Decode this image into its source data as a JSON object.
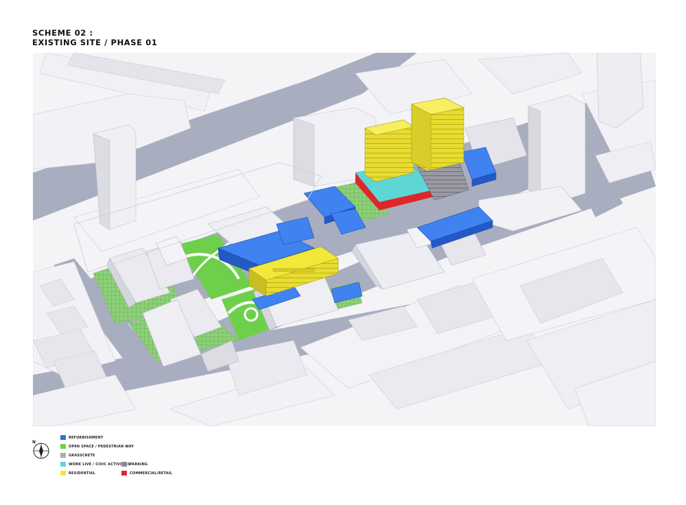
{
  "title": {
    "line1": "SCHEME 02 :",
    "line2": "EXISTING SITE / PHASE 01"
  },
  "legend": {
    "north_label": "N",
    "items": [
      {
        "label": "REFURBISHMENT",
        "color": "#2f6fe0",
        "pattern": "solid"
      },
      {
        "label": "OPEN SPACE / PEDESTRIAN WAY",
        "color": "#6ed04a",
        "pattern": "solid"
      },
      {
        "label": "GRASSCRETE",
        "color": "#c8c8c8",
        "pattern": "grid"
      },
      {
        "label": "WORK LIVE / CIVIC ACTIVITIES",
        "color": "#5fd6d6",
        "pattern": "solid"
      },
      {
        "label": "RESIDENTIAL",
        "color": "#f2e83a",
        "pattern": "solid"
      },
      {
        "label": "PARKING",
        "color": "#8c8c96",
        "pattern": "solid"
      },
      {
        "label": "COMMERCIAL/RETAIL",
        "color": "#e0262b",
        "pattern": "solid"
      }
    ]
  },
  "colors": {
    "road": "#a9adc0",
    "block_top": "#f3f3f6",
    "block_side": "#dcdce3",
    "block_dark": "#c8c9d2",
    "refurbishment": "#2f6fe0",
    "refurbishment_top": "#3f82f0",
    "open_space": "#6ed04a",
    "grasscrete": "#8ed07a",
    "work_live": "#5fd6d6",
    "residential": "#f2e83a",
    "residential_side": "#c9bd24",
    "parking": "#8c8c96",
    "commercial": "#e0262b"
  }
}
